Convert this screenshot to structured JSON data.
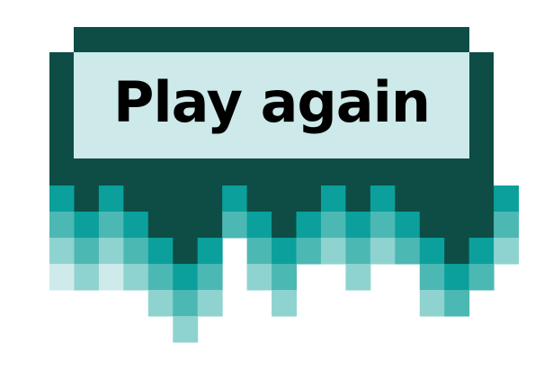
{
  "button": {
    "label": "Play again"
  },
  "colors": {
    "frame": "#0d4d45",
    "panel": "#cde9e9",
    "pixel_teal": "#0ba09c",
    "pixel_mid": "#4cb8b3",
    "pixel_light": "#8ed3cf",
    "pixel_pale": "#cfeaea",
    "text": "#000000"
  }
}
